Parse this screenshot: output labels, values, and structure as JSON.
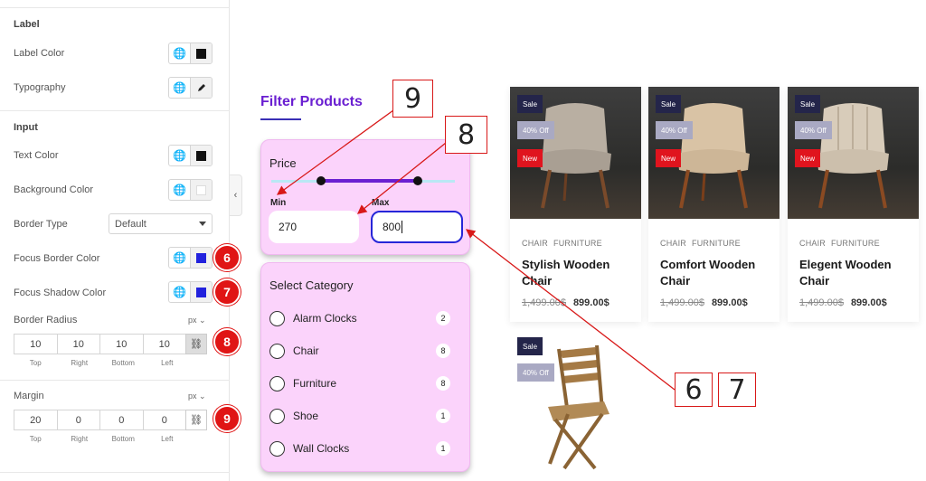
{
  "panel": {
    "label_section": "Label",
    "label_color": "Label Color",
    "typography": "Typography",
    "input_section": "Input",
    "text_color": "Text Color",
    "background_color": "Background Color",
    "border_type": "Border Type",
    "border_type_value": "Default",
    "focus_border_color": "Focus Border Color",
    "focus_shadow_color": "Focus Shadow Color",
    "border_radius": "Border Radius",
    "border_radius_unit": "px ⌄",
    "border_radius_values": [
      "10",
      "10",
      "10",
      "10"
    ],
    "margin": "Margin",
    "margin_unit": "px ⌄",
    "margin_values": [
      "20",
      "0",
      "0",
      "0"
    ],
    "dim_labels": [
      "Top",
      "Right",
      "Bottom",
      "Left"
    ],
    "swatches": {
      "label_color": "#111111",
      "text_color": "#111111",
      "background_color": "#ffffff",
      "focus_border_color": "#2222dd",
      "focus_shadow_color": "#2222dd"
    }
  },
  "badges": {
    "focus_border": "6",
    "focus_shadow": "7",
    "border_radius": "8",
    "margin": "9"
  },
  "filter": {
    "title": "Filter Products",
    "price_label": "Price",
    "min_label": "Min",
    "max_label": "Max",
    "min_value": "270",
    "max_value": "800",
    "category_title": "Select Category",
    "categories": [
      {
        "name": "Alarm Clocks",
        "count": "2"
      },
      {
        "name": "Chair",
        "count": "8"
      },
      {
        "name": "Furniture",
        "count": "8"
      },
      {
        "name": "Shoe",
        "count": "1"
      },
      {
        "name": "Wall Clocks",
        "count": "1"
      }
    ]
  },
  "products": [
    {
      "sale": "Sale",
      "off": "40% Off",
      "new": "New",
      "cat1": "CHAIR",
      "cat2": "FURNITURE",
      "name": "Stylish Wooden Chair",
      "old_price": "1,499.00$",
      "price": "899.00$"
    },
    {
      "sale": "Sale",
      "off": "40% Off",
      "new": "New",
      "cat1": "CHAIR",
      "cat2": "FURNITURE",
      "name": "Comfort Wooden Chair",
      "old_price": "1,499.00$",
      "price": "899.00$"
    },
    {
      "sale": "Sale",
      "off": "40% Off",
      "new": "New",
      "cat1": "CHAIR",
      "cat2": "FURNITURE",
      "name": "Elegent Wooden Chair",
      "old_price": "1,499.00$",
      "price": "899.00$"
    },
    {
      "sale": "Sale",
      "off": "40% Off"
    }
  ],
  "callouts": {
    "nine": "9",
    "eight": "8",
    "six": "6",
    "seven": "7"
  },
  "colors": {
    "accent": "#6a1fd1",
    "card_bg": "#fbd3fb",
    "badge_red": "#e01515",
    "focus_blue": "#2626d8"
  }
}
